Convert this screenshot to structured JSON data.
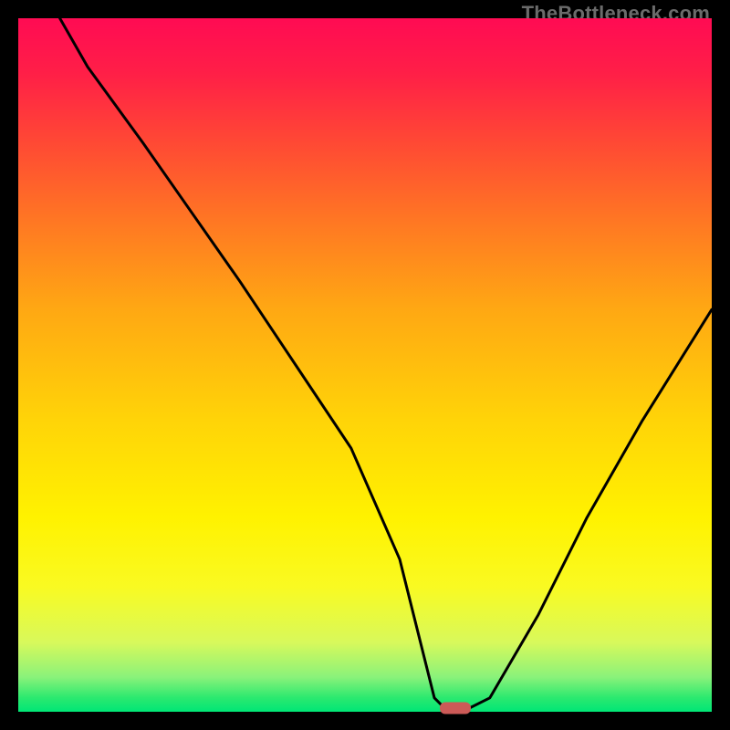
{
  "watermark": "TheBottleneck.com",
  "chart_data": {
    "type": "line",
    "title": "",
    "xlabel": "",
    "ylabel": "",
    "xlim": [
      0,
      100
    ],
    "ylim": [
      0,
      100
    ],
    "x": [
      6,
      10,
      18,
      25,
      32,
      40,
      48,
      55,
      58,
      60,
      62,
      64,
      68,
      75,
      82,
      90,
      100
    ],
    "values": [
      100,
      93,
      82,
      72,
      62,
      50,
      38,
      22,
      10,
      2,
      0,
      0,
      2,
      14,
      28,
      42,
      58
    ],
    "marker": {
      "x": 63,
      "y": 0
    },
    "gradient_stops": [
      {
        "pos": 0,
        "color": "#ff0b53"
      },
      {
        "pos": 8,
        "color": "#ff1f47"
      },
      {
        "pos": 18,
        "color": "#ff4934"
      },
      {
        "pos": 30,
        "color": "#ff7a22"
      },
      {
        "pos": 42,
        "color": "#ffa813"
      },
      {
        "pos": 58,
        "color": "#ffd408"
      },
      {
        "pos": 72,
        "color": "#fff200"
      },
      {
        "pos": 82,
        "color": "#f9fa22"
      },
      {
        "pos": 90,
        "color": "#d8f95b"
      },
      {
        "pos": 95,
        "color": "#8af27a"
      },
      {
        "pos": 98,
        "color": "#2be96f"
      },
      {
        "pos": 100,
        "color": "#00e676"
      }
    ]
  }
}
